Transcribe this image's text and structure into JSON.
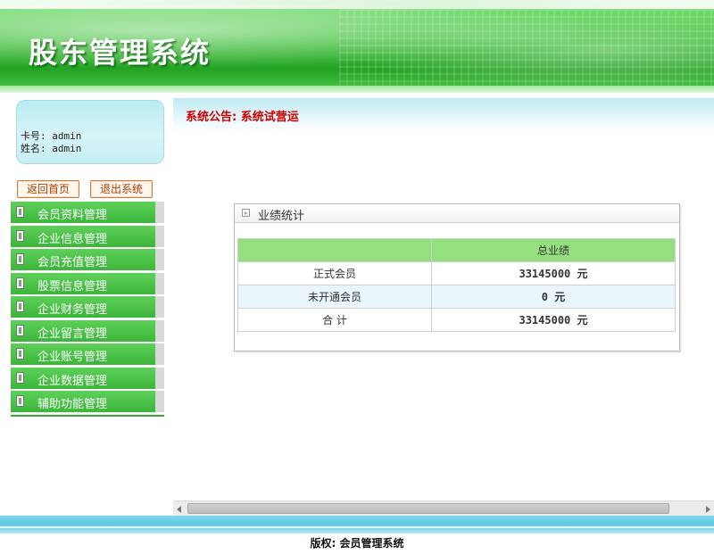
{
  "header": {
    "title": "股东管理系统"
  },
  "user": {
    "card_line": "卡号: admin",
    "name_line": "姓名: admin"
  },
  "actions": {
    "home_label": "返回首页",
    "exit_label": "退出系统"
  },
  "menu": {
    "items": [
      {
        "label": "会员资料管理"
      },
      {
        "label": "企业信息管理"
      },
      {
        "label": "会员充值管理"
      },
      {
        "label": "股票信息管理"
      },
      {
        "label": "企业财务管理"
      },
      {
        "label": "企业留言管理"
      },
      {
        "label": "企业账号管理"
      },
      {
        "label": "企业数据管理"
      },
      {
        "label": "辅助功能管理"
      }
    ]
  },
  "notice": {
    "text": "系统公告: 系统试营运"
  },
  "stats": {
    "title": "业绩统计",
    "column_header": "总业绩",
    "rows": [
      {
        "label": "正式会员",
        "value": "33145000 元"
      },
      {
        "label": "未开通会员",
        "value": "0 元"
      },
      {
        "label": "合 计",
        "value": "33145000 元"
      }
    ]
  },
  "footer": {
    "text": "版权: 会员管理系统"
  },
  "colors": {
    "header_green": "#3fbf3a",
    "menu_green": "#4cc548",
    "notice_red": "#cc0000",
    "table_header_green": "#94e07f",
    "footer_blue": "#5ec8e0"
  }
}
